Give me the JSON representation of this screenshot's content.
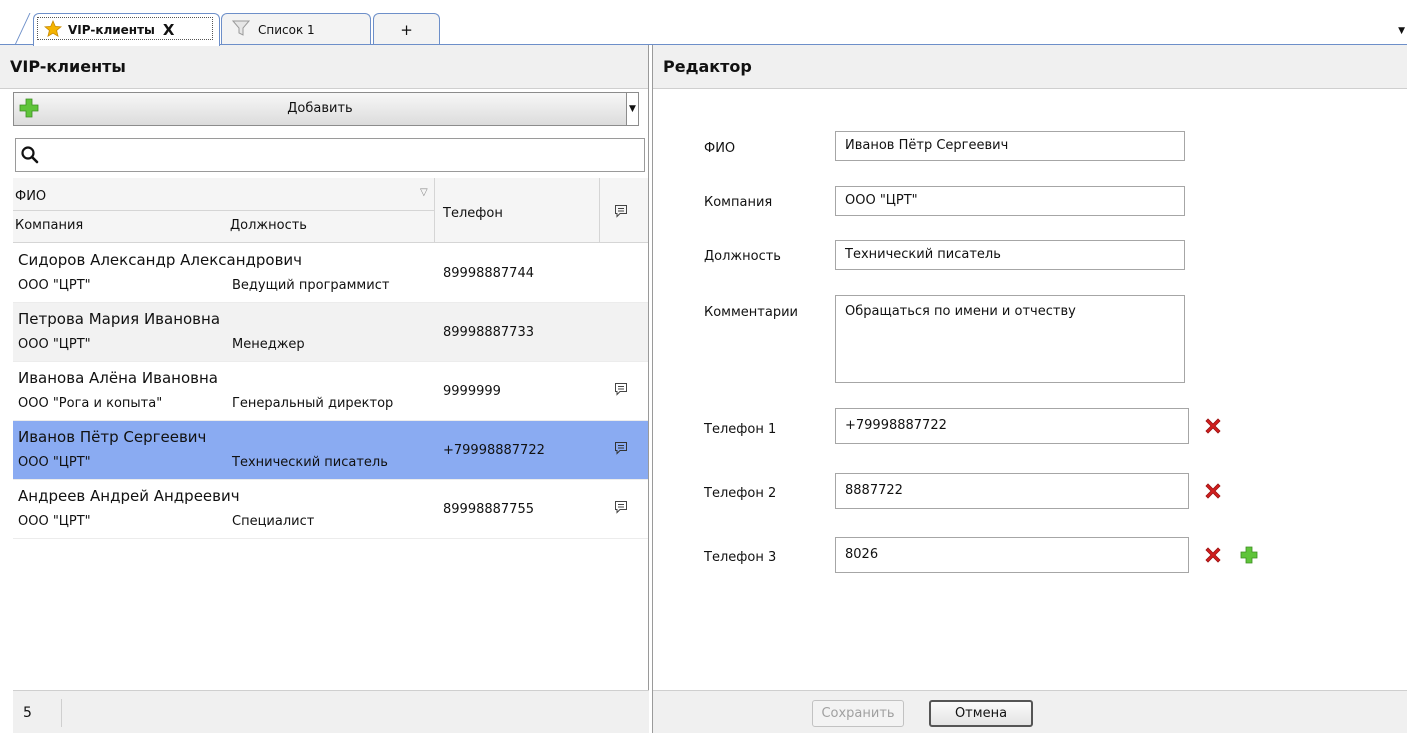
{
  "tabs": [
    {
      "label": "VIP-клиенты",
      "icon": "star-icon",
      "close": "X",
      "active": true
    },
    {
      "label": "Список 1",
      "icon": "filter-icon",
      "active": false
    },
    {
      "label": "+",
      "active": false
    }
  ],
  "left": {
    "title": "VIP-клиенты",
    "add_label": "Добавить",
    "search_placeholder": "",
    "columns": {
      "fio": "ФИО",
      "company": "Компания",
      "position": "Должность",
      "phone": "Телефон"
    },
    "rows": [
      {
        "name": "Сидоров Александр Александрович",
        "company": "ООО \"ЦРТ\"",
        "position": "Ведущий программист",
        "phone": "89998887744",
        "has_comment": false
      },
      {
        "name": "Петрова Мария Ивановна",
        "company": "ООО \"ЦРТ\"",
        "position": "Менеджер",
        "phone": "89998887733",
        "has_comment": false
      },
      {
        "name": "Иванова Алёна Ивановна",
        "company": "ООО \"Рога и копыта\"",
        "position": "Генеральный директор",
        "phone": "9999999",
        "has_comment": true
      },
      {
        "name": "Иванов Пётр Сергеевич",
        "company": "ООО \"ЦРТ\"",
        "position": "Технический писатель",
        "phone": "+79998887722",
        "has_comment": true,
        "selected": true
      },
      {
        "name": "Андреев Андрей Андреевич",
        "company": "ООО \"ЦРТ\"",
        "position": "Специалист",
        "phone": "89998887755",
        "has_comment": true
      }
    ],
    "count": "5"
  },
  "editor": {
    "title": "Редактор",
    "fio_label": "ФИО",
    "fio_value": "Иванов Пётр Сергеевич",
    "company_label": "Компания",
    "company_value": "ООО \"ЦРТ\"",
    "position_label": "Должность",
    "position_value": "Технический писатель",
    "comments_label": "Комментарии",
    "comments_value": "Обращаться по имени и отчеству",
    "phones": [
      {
        "label": "Телефон 1",
        "value": "+79998887722"
      },
      {
        "label": "Телефон 2",
        "value": "8887722"
      },
      {
        "label": "Телефон 3",
        "value": "8026"
      }
    ],
    "save_label": "Сохранить",
    "cancel_label": "Отмена"
  },
  "colors": {
    "selected_row": "#8aabf2",
    "accent_border": "#6d8fc9",
    "delete_red": "#d21f1f",
    "add_green": "#5fc43a"
  }
}
